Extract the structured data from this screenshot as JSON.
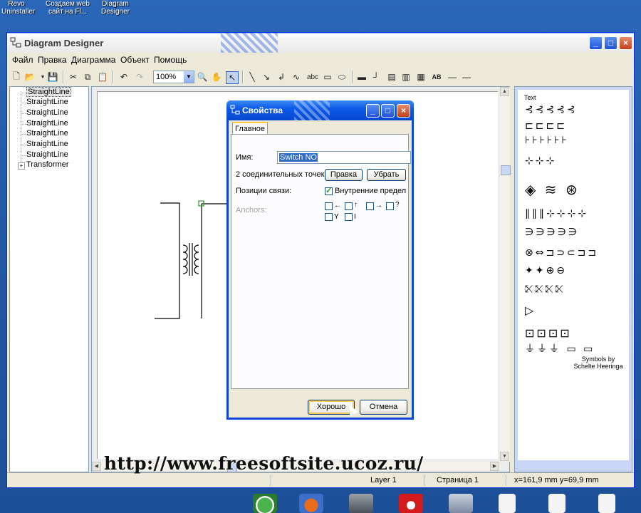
{
  "desktop": {
    "icons": [
      {
        "label_line1": "Revo",
        "label_line2": "Uninstaller"
      },
      {
        "label_line1": "Создаем web",
        "label_line2": "сайт на Fl..."
      },
      {
        "label_line1": "Diagram",
        "label_line2": "Designer"
      }
    ]
  },
  "window": {
    "title": "Diagram Designer"
  },
  "menu": [
    "Файл",
    "Правка",
    "Диаграмма",
    "Объект",
    "Помощь"
  ],
  "toolbar": {
    "zoom": "100%",
    "text_tool": "abc"
  },
  "tree": {
    "items": [
      "StraightLine",
      "StraightLine",
      "StraightLine",
      "StraightLine",
      "StraightLine",
      "StraightLine",
      "StraightLine",
      "Transformer"
    ]
  },
  "symbols": {
    "header": "Text",
    "credit_line1": "Symbols by",
    "credit_line2": "Schelte Heeringa"
  },
  "status": {
    "layer": "Layer 1",
    "page": "Страница 1",
    "coords": "x=161,9 mm  y=69,9 mm"
  },
  "dialog": {
    "title": "Свойства",
    "tab": "Главное",
    "name_label": "Имя:",
    "name_value": "Switch NO",
    "connection_points_label": "2 соединительных точек:",
    "edit_button": "Правка",
    "remove_button": "Убрать",
    "link_positions_label": "Позиции связи:",
    "inner_limits_label": "Внутренние предел",
    "inner_limits_checked": true,
    "anchors_label": "Anchors:",
    "ok_button": "Хорошо",
    "cancel_button": "Отмена"
  },
  "watermark": "http://www.freesoftsite.ucoz.ru/"
}
